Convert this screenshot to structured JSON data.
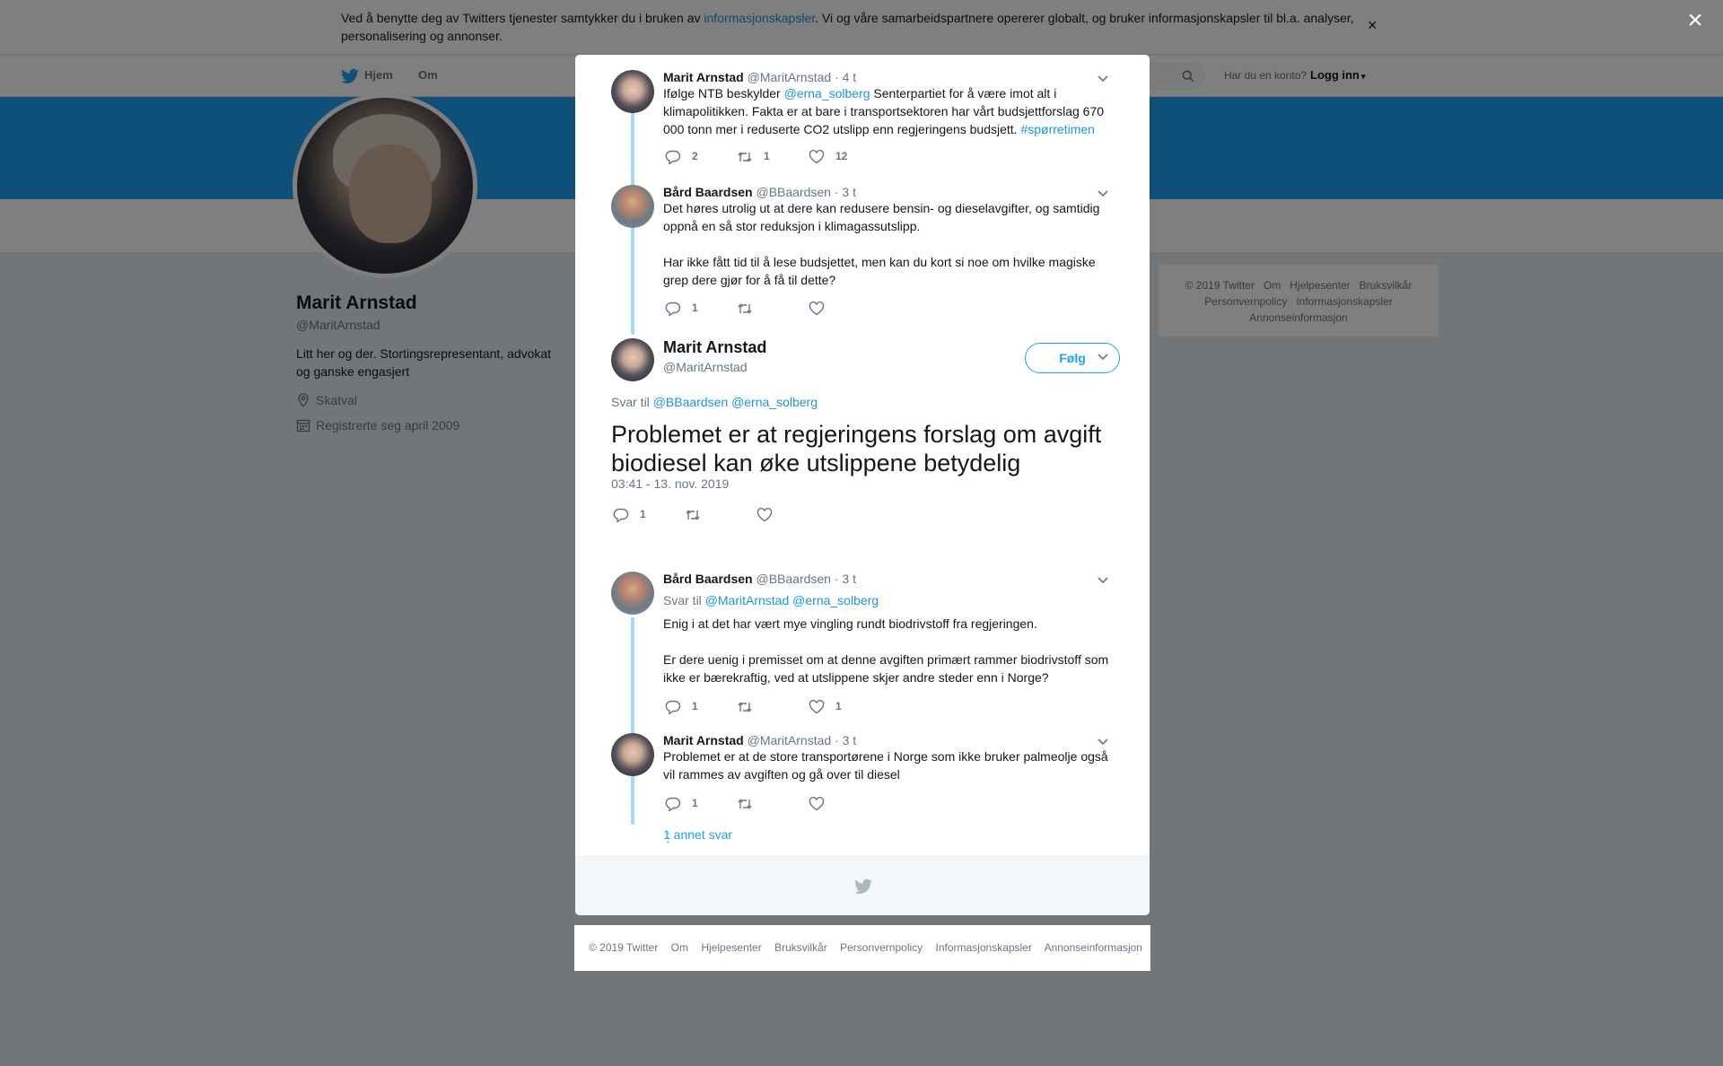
{
  "cookie_bar": {
    "text_before": "Ved å benytte deg av Twitters tjenester samtykker du i bruken av ",
    "link": "informasjonskapsler",
    "text_after": ". Vi og våre samarbeidspartnere opererer globalt, og bruker informasjonskapsler til bl.a. analyser, personalisering og annonser.",
    "close": "×"
  },
  "nav": {
    "home": "Hjem",
    "about": "Om",
    "login_question": "Har du en konto?",
    "login": "Logg inn"
  },
  "profile": {
    "name": "Marit Arnstad",
    "handle": "@MaritArnstad",
    "bio": "Litt her og der. Stortingsrepresentant, advokat og ganske engasjert",
    "location": "Skatval",
    "joined": "Registrerte seg april 2009"
  },
  "side_footer": [
    "© 2019 Twitter",
    "Om",
    "Hjelpesenter",
    "Bruksvilkår",
    "Personvernpolicy",
    "Informasjonskapsler",
    "Annonseinformasjon"
  ],
  "overlay_close": "×",
  "thread": [
    {
      "name": "Marit Arnstad",
      "handle": "@MaritArnstad",
      "time": "· 4 t",
      "text_parts": [
        "Ifølge NTB beskylder ",
        "@erna_solberg",
        " Senterpartiet for å være imot alt i klimapolitikken. Fakta er at bare i transportsektoren har vårt budsjettforslag 670 000 tonn mer i reduserte CO2 utslipp enn regjeringens budsjett. ",
        "#spørretimen"
      ],
      "replies": "2",
      "retweets": "1",
      "likes": "12"
    },
    {
      "name": "Bård Baardsen",
      "handle": "@BBaardsen",
      "time": "· 3 t",
      "text": "Det høres utrolig ut at dere kan redusere bensin- og dieselavgifter, og samtidig oppnå en så stor reduksjon i klimagassutslipp.\n\nHar ikke fått tid til å lese budsjettet, men kan du kort si noe om hvilke magiske grep dere gjør for å få til dette?",
      "replies": "1",
      "retweets": "",
      "likes": ""
    }
  ],
  "main_tweet": {
    "name": "Marit Arnstad",
    "handle": "@MaritArnstad",
    "follow": "Følg",
    "reply_to_label": "Svar til",
    "reply_to_1": "@BBaardsen",
    "reply_to_2": "@erna_solberg",
    "text": "Problemet er at regjeringens forslag om avgift biodiesel kan øke utslippene betydelig",
    "timestamp": "03:41 - 13. nov. 2019",
    "replies": "1",
    "retweets": "",
    "likes": ""
  },
  "replies": [
    {
      "name": "Bård Baardsen",
      "handle": "@BBaardsen",
      "time": "· 3 t",
      "reply_to_label": "Svar til",
      "reply_to_1": "@MaritArnstad",
      "reply_to_2": "@erna_solberg",
      "text": "Enig i at det har vært mye vingling rundt biodrivstoff fra regjeringen.\n\nEr dere uenig i premisset om at denne avgiften primært rammer biodrivstoff som ikke er bærekraftig, ved at utslippene skjer andre steder enn i Norge?",
      "replies": "1",
      "retweets": "",
      "likes": "1"
    },
    {
      "name": "Marit Arnstad",
      "handle": "@MaritArnstad",
      "time": "· 3 t",
      "text": "Problemet er at de store transportørene i Norge som ikke bruker palmeolje også vil rammes av avgiften og gå over til diesel",
      "replies": "1",
      "retweets": "",
      "likes": ""
    }
  ],
  "more_replies": "1 annet svar",
  "modal_footer": [
    "© 2019 Twitter",
    "Om",
    "Hjelpesenter",
    "Bruksvilkår",
    "Personvernpolicy",
    "Informasjonskapsler",
    "Annonseinformasjon"
  ],
  "colors": {
    "accent": "#1da1f2",
    "link": "#1b95e0",
    "thread_line": "#a8d7f5",
    "secondary_text": "#657786"
  }
}
